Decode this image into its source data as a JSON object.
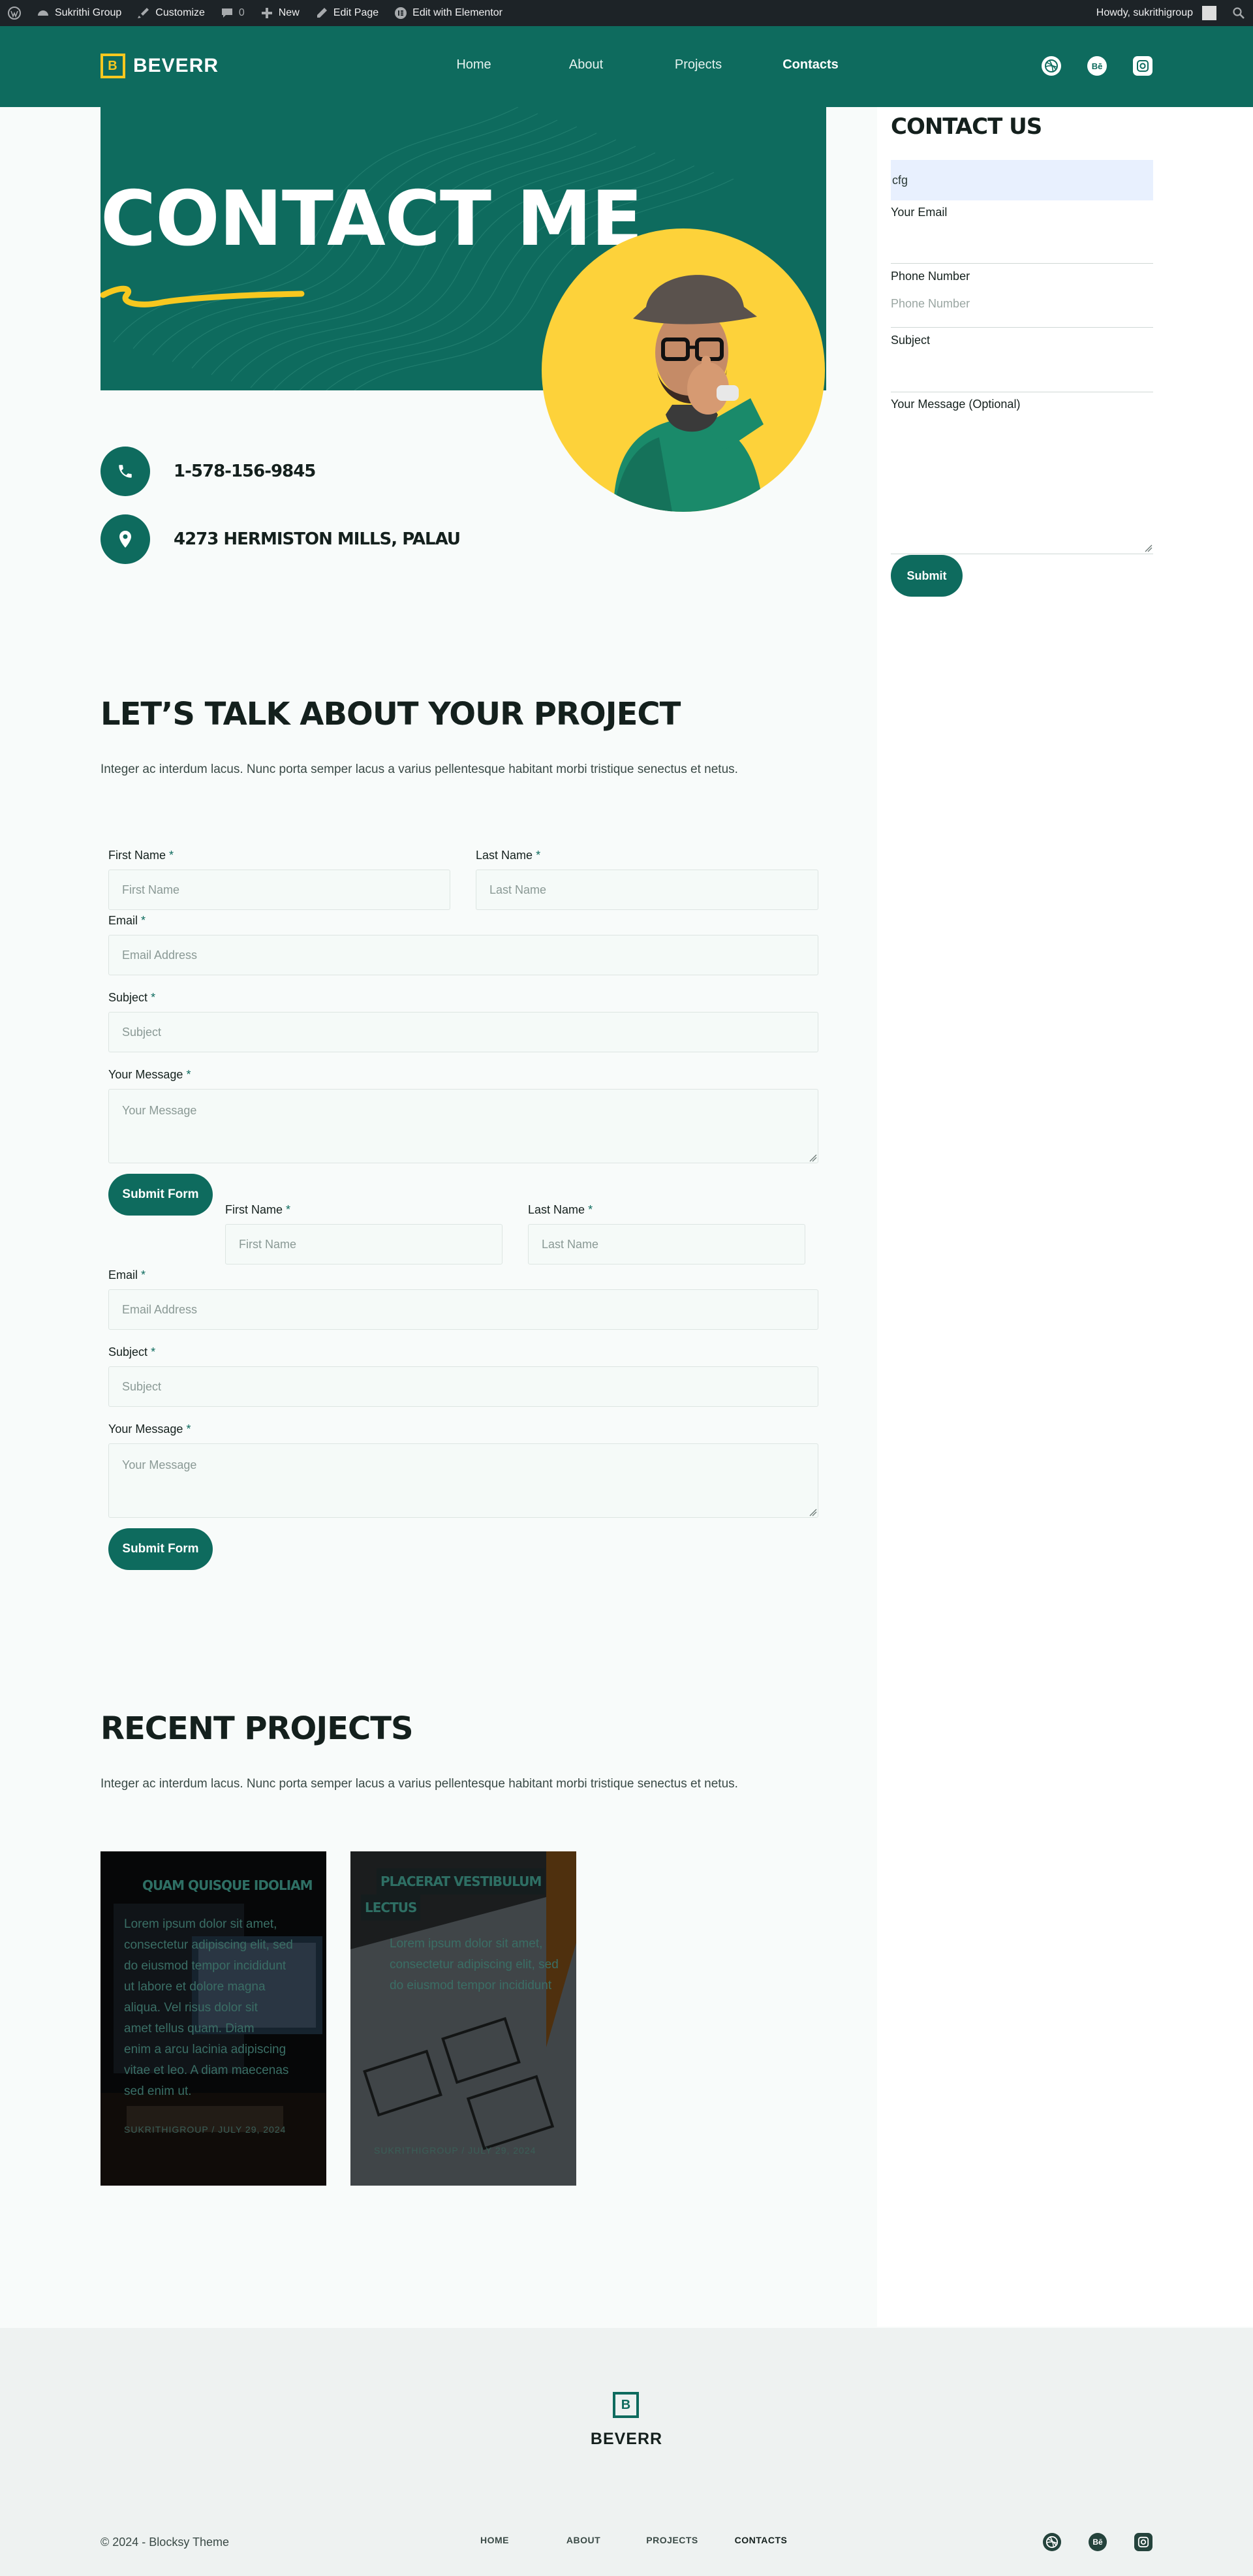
{
  "adminbar": {
    "site": "Sukrithi Group",
    "customize": "Customize",
    "comments": "0",
    "new": "New",
    "edit_page": "Edit Page",
    "elementor": "Edit with Elementor",
    "howdy": "Howdy, sukrithigroup"
  },
  "header": {
    "logo_letter": "B",
    "logo_text": "BEVERR",
    "nav": [
      "Home",
      "About",
      "Projects",
      "Contacts"
    ],
    "social": [
      "dribbble-icon",
      "behance-icon",
      "instagram-icon"
    ],
    "behance_text": "Bē"
  },
  "hero": {
    "title": "CONTACT ME",
    "phone": "1-578-156-9845",
    "address": "4273 HERMISTON MILLS, PALAU"
  },
  "sidebar": {
    "title": "CONTACT US",
    "first_value": "cfg",
    "email_label": "Your Email",
    "phone_label": "Phone Number",
    "phone_placeholder": "Phone Number",
    "subject_label": "Subject",
    "message_label": "Your Message (Optional)",
    "submit": "Submit"
  },
  "talk": {
    "title": "LET’S TALK ABOUT YOUR PROJECT",
    "text": "Integer ac interdum lacus. Nunc porta semper lacus a varius pellentesque habitant morbi tristique senectus et netus.",
    "first_name_label": "First Name",
    "first_name_placeholder": "First Name",
    "last_name_label": "Last Name",
    "last_name_placeholder": "Last Name",
    "email_label": "Email",
    "email_placeholder": "Email Address",
    "subject_label": "Subject",
    "subject_placeholder": "Subject",
    "message_label": "Your Message",
    "message_placeholder": "Your Message",
    "required": "*",
    "submit": "Submit Form"
  },
  "projects": {
    "title": "RECENT PROJECTS",
    "text": "Integer ac interdum lacus. Nunc porta semper lacus a varius pellentesque habitant morbi tristique senectus et netus.",
    "cards": [
      {
        "title": "QUAM QUISQUE IDOLIAM",
        "body": [
          "Lorem ipsum dolor sit amet,",
          "consectetur adipiscing elit, sed",
          "do eiusmod tempor incididunt",
          "ut labore et dolore magna",
          "aliqua. Vel risus dolor sit",
          "amet tellus quam. Diam",
          "enim a arcu lacinia adipiscing",
          "vitae et leo. A diam maecenas",
          "sed enim ut."
        ],
        "meta": "SUKRITHIGROUP / JULY 29, 2024"
      },
      {
        "title": "PLACERAT VESTIBULUM",
        "title2": "LECTUS",
        "body": [
          "Lorem ipsum dolor sit amet,",
          "consectetur adipiscing elit, sed",
          "do eiusmod tempor incididunt"
        ],
        "meta": "SUKRITHIGROUP / JULY 29, 2024"
      }
    ]
  },
  "footer": {
    "logo_letter": "B",
    "logo_text": "BEVERR",
    "copyright": "© 2024 - Blocksy Theme",
    "nav": [
      "HOME",
      "ABOUT",
      "PROJECTS",
      "CONTACTS"
    ]
  }
}
